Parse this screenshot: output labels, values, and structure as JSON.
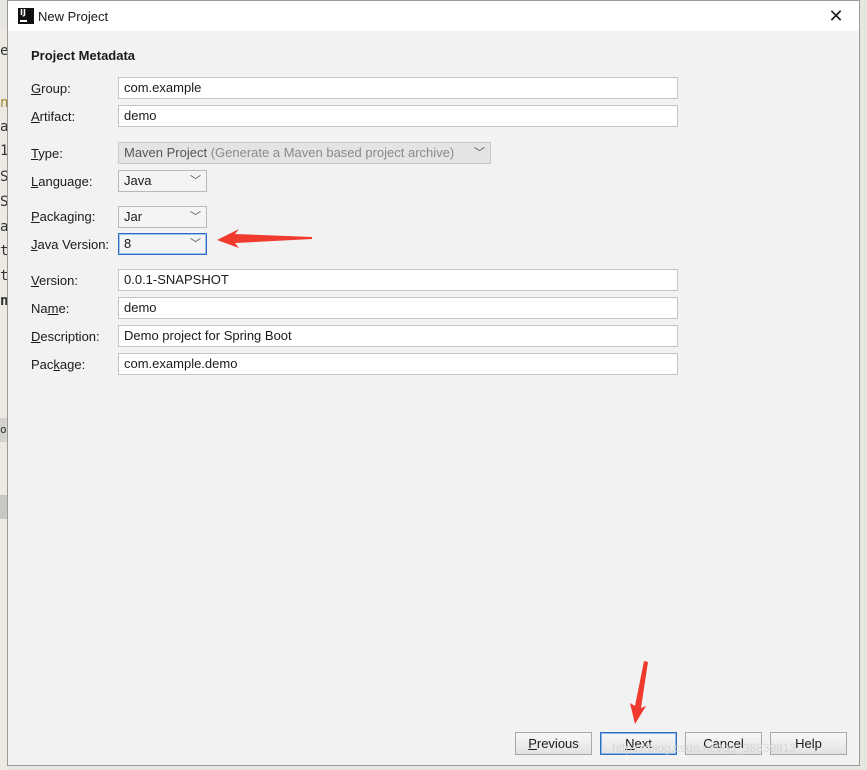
{
  "window": {
    "title": "New Project"
  },
  "section": {
    "title": "Project Metadata"
  },
  "form": {
    "group": {
      "label_pre": "",
      "label_key": "G",
      "label_post": "roup:",
      "value": "com.example"
    },
    "artifact": {
      "label_pre": "",
      "label_key": "A",
      "label_post": "rtifact:",
      "value": "demo"
    },
    "type": {
      "label_pre": "",
      "label_key": "T",
      "label_post": "ype:",
      "value": "Maven Project",
      "hint": "(Generate a Maven based project archive)"
    },
    "language": {
      "label_pre": "",
      "label_key": "L",
      "label_post": "anguage:",
      "value": "Java"
    },
    "packaging": {
      "label_pre": "",
      "label_key": "P",
      "label_post": "ackaging:",
      "value": "Jar"
    },
    "javaVersion": {
      "label_pre": "",
      "label_key": "J",
      "label_post": "ava Version:",
      "value": "8"
    },
    "version": {
      "label_pre": "",
      "label_key": "V",
      "label_post": "ersion:",
      "value": "0.0.1-SNAPSHOT"
    },
    "name": {
      "label_pre": "Na",
      "label_key": "m",
      "label_post": "e:",
      "value": "demo"
    },
    "description": {
      "label_pre": "",
      "label_key": "D",
      "label_post": "escription:",
      "value": "Demo project for Spring Boot"
    },
    "package": {
      "label_pre": "Pac",
      "label_key": "k",
      "label_post": "age:",
      "value": "com.example.demo"
    }
  },
  "buttons": {
    "previous": {
      "pre": "",
      "key": "P",
      "post": "revious"
    },
    "next": {
      "pre": "",
      "key": "N",
      "post": "ext"
    },
    "cancel": {
      "label": "Cancel"
    },
    "help": {
      "label": "Help"
    }
  },
  "background_chars": [
    "e",
    "n",
    "a",
    "1",
    "S",
    "S",
    "a",
    "t",
    "t",
    "n",
    "ol"
  ],
  "watermark": "https://blog.csdn.net/qq_38839813",
  "colors": {
    "annotation_arrow": "#f03a2e",
    "focus_border": "#2f6fbf"
  },
  "icons": {
    "app": "intellij-idea-icon",
    "close": "close-icon",
    "dropdown": "chevron-down-icon"
  }
}
